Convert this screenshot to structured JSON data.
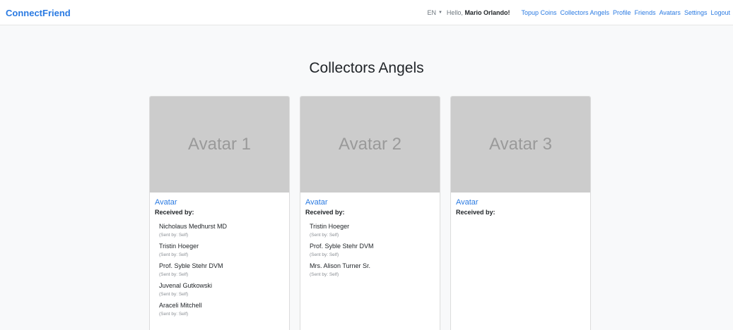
{
  "nav": {
    "brand": "ConnectFriend",
    "language": "EN",
    "greeting_prefix": "Hello,",
    "user_name": "Mario Orlando!",
    "links": [
      "Topup Coins",
      "Collectors Angels",
      "Profile",
      "Friends",
      "Avatars",
      "Settings",
      "Logout"
    ]
  },
  "page": {
    "title": "Collectors Angels"
  },
  "cards": [
    {
      "image_label": "Avatar 1",
      "link": "Avatar",
      "received_label": "Received by:",
      "recipients": [
        {
          "name": "Nicholaus Medhurst MD",
          "sent": "(Sent by: Self)"
        },
        {
          "name": "Tristin Hoeger",
          "sent": "(Sent by: Self)"
        },
        {
          "name": "Prof. Syble Stehr DVM",
          "sent": "(Sent by: Self)"
        },
        {
          "name": "Juvenal Gutkowski",
          "sent": "(Sent by: Self)"
        },
        {
          "name": "Araceli Mitchell",
          "sent": "(Sent by: Self)"
        }
      ]
    },
    {
      "image_label": "Avatar 2",
      "link": "Avatar",
      "received_label": "Received by:",
      "recipients": [
        {
          "name": "Tristin Hoeger",
          "sent": "(Sent by: Self)"
        },
        {
          "name": "Prof. Syble Stehr DVM",
          "sent": "(Sent by: Self)"
        },
        {
          "name": "Mrs. Alison Turner Sr.",
          "sent": "(Sent by: Self)"
        }
      ]
    },
    {
      "image_label": "Avatar 3",
      "link": "Avatar",
      "received_label": "Received by:",
      "recipients": []
    }
  ]
}
